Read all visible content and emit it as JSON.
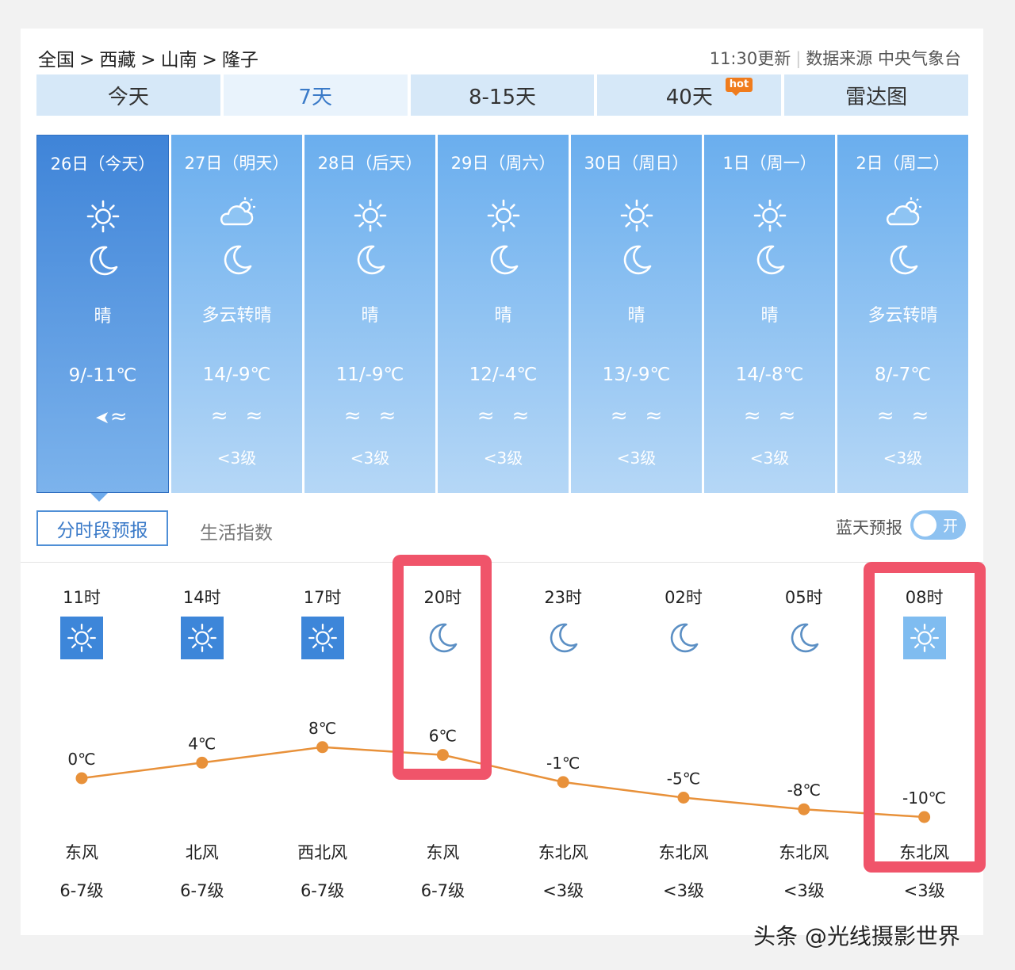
{
  "breadcrumb": [
    "全国",
    "西藏",
    "山南",
    "隆子"
  ],
  "breadcrumb_sep": ">",
  "update": "11:30更新",
  "source": "数据来源 中央气象台",
  "tabs": [
    {
      "label": "今天"
    },
    {
      "label": "7天",
      "active": true
    },
    {
      "label": "8-15天"
    },
    {
      "label": "40天",
      "badge": "hot"
    },
    {
      "label": "雷达图"
    }
  ],
  "days": [
    {
      "date": "26日（今天）",
      "day_icon": "sun-icon",
      "night_icon": "moon-icon",
      "weather": "晴",
      "temp": "9/-11℃",
      "wind_icons": [
        "wind-arrow-icon",
        "wind-wave-icon"
      ],
      "level": ""
    },
    {
      "date": "27日（明天）",
      "day_icon": "partly-cloudy-icon",
      "night_icon": "moon-icon",
      "weather": "多云转晴",
      "temp": "14/-9℃",
      "wind_icons": [
        "wind-wave-icon",
        "wind-wave-icon"
      ],
      "level": "<3级"
    },
    {
      "date": "28日（后天）",
      "day_icon": "sun-icon",
      "night_icon": "moon-icon",
      "weather": "晴",
      "temp": "11/-9℃",
      "wind_icons": [
        "wind-wave-icon",
        "wind-wave-icon"
      ],
      "level": "<3级"
    },
    {
      "date": "29日（周六）",
      "day_icon": "sun-icon",
      "night_icon": "moon-icon",
      "weather": "晴",
      "temp": "12/-4℃",
      "wind_icons": [
        "wind-wave-icon",
        "wind-wave-icon"
      ],
      "level": "<3级"
    },
    {
      "date": "30日（周日）",
      "day_icon": "sun-icon",
      "night_icon": "moon-icon",
      "weather": "晴",
      "temp": "13/-9℃",
      "wind_icons": [
        "wind-wave-icon",
        "wind-wave-icon"
      ],
      "level": "<3级"
    },
    {
      "date": "1日（周一）",
      "day_icon": "sun-icon",
      "night_icon": "moon-icon",
      "weather": "晴",
      "temp": "14/-8℃",
      "wind_icons": [
        "wind-wave-icon",
        "wind-wave-icon"
      ],
      "level": "<3级"
    },
    {
      "date": "2日（周二）",
      "day_icon": "partly-cloudy-icon",
      "night_icon": "moon-icon",
      "weather": "多云转晴",
      "temp": "8/-7℃",
      "wind_icons": [
        "wind-wave-icon",
        "wind-wave-icon"
      ],
      "level": "<3级"
    }
  ],
  "subtabs": [
    "分时段预报",
    "生活指数"
  ],
  "bluesky_label": "蓝天预报",
  "toggle_label": "开",
  "hourly": [
    {
      "time": "11时",
      "icon": "sun-icon",
      "temp": 0,
      "temp_label": "0℃",
      "wind": "东风",
      "level": "6-7级"
    },
    {
      "time": "14时",
      "icon": "sun-icon",
      "temp": 4,
      "temp_label": "4℃",
      "wind": "北风",
      "level": "6-7级"
    },
    {
      "time": "17时",
      "icon": "sun-icon",
      "temp": 8,
      "temp_label": "8℃",
      "wind": "西北风",
      "level": "6-7级"
    },
    {
      "time": "20时",
      "icon": "moon-icon",
      "temp": 6,
      "temp_label": "6℃",
      "wind": "东风",
      "level": "6-7级",
      "highlight": true
    },
    {
      "time": "23时",
      "icon": "moon-icon",
      "temp": -1,
      "temp_label": "-1℃",
      "wind": "东北风",
      "level": "<3级"
    },
    {
      "time": "02时",
      "icon": "moon-icon",
      "temp": -5,
      "temp_label": "-5℃",
      "wind": "东北风",
      "level": "<3级"
    },
    {
      "time": "05时",
      "icon": "moon-icon",
      "temp": -8,
      "temp_label": "-8℃",
      "wind": "东北风",
      "level": "<3级"
    },
    {
      "time": "08时",
      "icon": "sun-icon",
      "temp": -10,
      "temp_label": "-10℃",
      "wind": "东北风",
      "level": "<3级",
      "highlight": true
    }
  ],
  "colors": {
    "line": "#e8913a",
    "sunbox": "#3d86d9",
    "sunbox_light": "#7fbcf0",
    "moon": "#5b8fc4",
    "highlight": "#f0546a"
  },
  "watermark": "头条 @光线摄影世界"
}
